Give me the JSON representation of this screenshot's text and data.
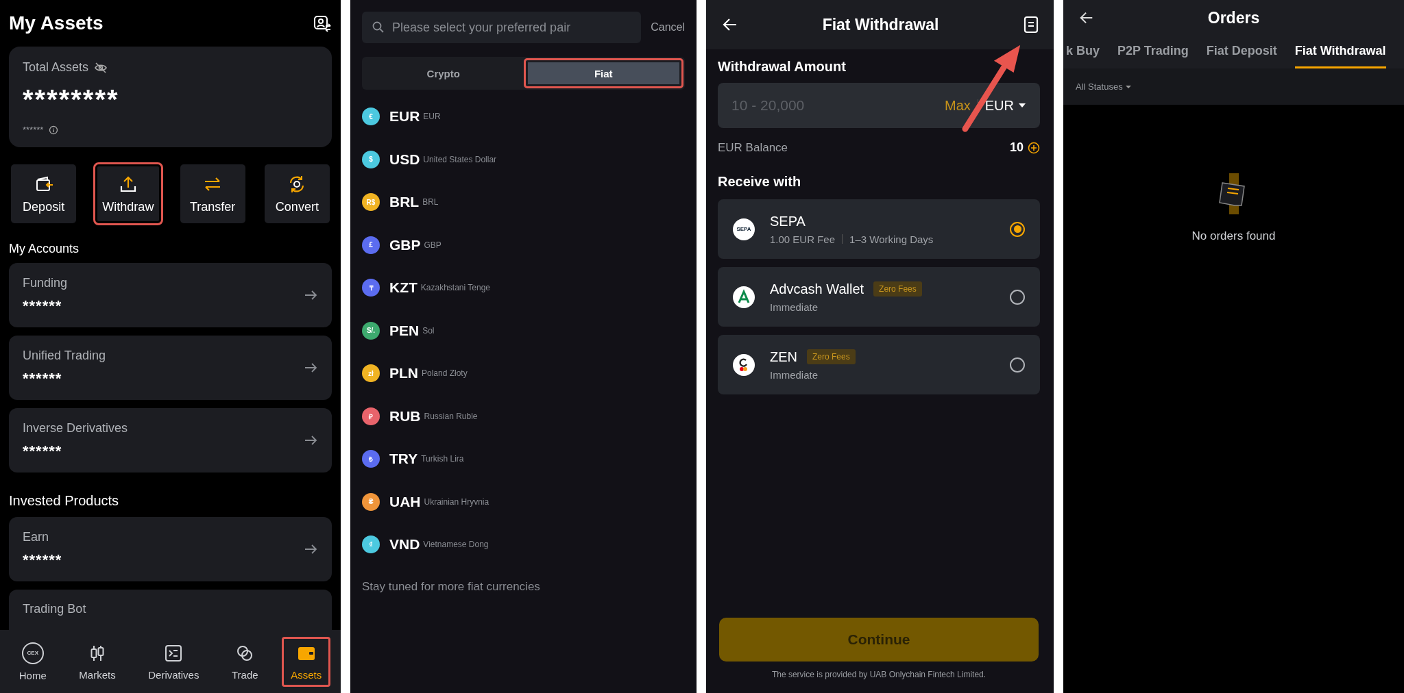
{
  "assets_screen": {
    "title": "My Assets",
    "total_card": {
      "label": "Total Assets",
      "value": "********",
      "sub_value": "******"
    },
    "actions": [
      {
        "label": "Deposit",
        "kind": "deposit",
        "highlighted": false
      },
      {
        "label": "Withdraw",
        "kind": "withdraw",
        "highlighted": true
      },
      {
        "label": "Transfer",
        "kind": "transfer",
        "highlighted": false
      },
      {
        "label": "Convert",
        "kind": "convert",
        "highlighted": false
      }
    ],
    "accounts_heading": "My Accounts",
    "accounts": [
      {
        "name": "Funding",
        "value": "******"
      },
      {
        "name": "Unified Trading",
        "value": "******"
      },
      {
        "name": "Inverse Derivatives",
        "value": "******"
      }
    ],
    "invested_heading": "Invested Products",
    "invested": [
      {
        "name": "Earn",
        "value": "******"
      },
      {
        "name": "Trading Bot"
      }
    ],
    "nav": [
      {
        "label": "Home",
        "kind": "home",
        "icon_text": "CEX",
        "selected": false,
        "highlighted": false
      },
      {
        "label": "Markets",
        "kind": "markets",
        "selected": false,
        "highlighted": false
      },
      {
        "label": "Derivatives",
        "kind": "derivatives",
        "selected": false,
        "highlighted": false
      },
      {
        "label": "Trade",
        "kind": "trade",
        "selected": false,
        "highlighted": false
      },
      {
        "label": "Assets",
        "kind": "assets",
        "selected": true,
        "highlighted": true
      }
    ]
  },
  "currency_screen": {
    "search": {
      "placeholder": "Please select your preferred pair"
    },
    "cancel": "Cancel",
    "tabs": [
      {
        "label": "Crypto",
        "selected": false,
        "highlighted": false
      },
      {
        "label": "Fiat",
        "selected": true,
        "highlighted": true
      }
    ],
    "currencies": [
      {
        "code": "EUR",
        "name": "EUR",
        "symbol": "€",
        "color": "#4cc9e0"
      },
      {
        "code": "USD",
        "name": "United States Dollar",
        "symbol": "$",
        "color": "#4cc9e0"
      },
      {
        "code": "BRL",
        "name": "BRL",
        "symbol": "R$",
        "color": "#f0b323"
      },
      {
        "code": "GBP",
        "name": "GBP",
        "symbol": "£",
        "color": "#5b6cf0"
      },
      {
        "code": "KZT",
        "name": "Kazakhstani Tenge",
        "symbol": "₸",
        "color": "#5b6cf0"
      },
      {
        "code": "PEN",
        "name": "Sol",
        "symbol": "S/.",
        "color": "#3daa6e"
      },
      {
        "code": "PLN",
        "name": "Poland Złoty",
        "symbol": "zł",
        "color": "#f0b323"
      },
      {
        "code": "RUB",
        "name": "Russian Ruble",
        "symbol": "₽",
        "color": "#e8636b"
      },
      {
        "code": "TRY",
        "name": "Turkish Lira",
        "symbol": "₺",
        "color": "#5b6cf0"
      },
      {
        "code": "UAH",
        "name": "Ukrainian Hryvnia",
        "symbol": "₴",
        "color": "#f0953a"
      },
      {
        "code": "VND",
        "name": "Vietnamese Dong",
        "symbol": "₫",
        "color": "#4cc9e0"
      }
    ],
    "footer": "Stay tuned for more fiat currencies"
  },
  "withdrawal_screen": {
    "title": "Fiat Withdrawal",
    "amount_label": "Withdrawal Amount",
    "amount": {
      "placeholder": "10 - 20,000",
      "max": "Max",
      "currency": "EUR"
    },
    "balance_label": "EUR Balance",
    "balance": "10",
    "receive_heading": "Receive with",
    "methods": [
      {
        "name": "SEPA",
        "kind": "sepa",
        "logo_text": "SEPA",
        "details": [
          "1.00 EUR Fee",
          "1–3 Working Days"
        ],
        "selected": true
      },
      {
        "name": "Advcash Wallet",
        "kind": "advcash",
        "badge": "Zero Fees",
        "details": [
          "Immediate"
        ],
        "selected": false
      },
      {
        "name": "ZEN",
        "kind": "zen",
        "badge": "Zero Fees",
        "details": [
          "Immediate"
        ],
        "selected": false
      }
    ],
    "continue_button": {
      "label": "Continue",
      "disabled": true
    },
    "footer": "The service is provided by UAB Onlychain Fintech Limited."
  },
  "orders_screen": {
    "title": "Orders",
    "tabs": [
      {
        "label": "k Buy",
        "selected": false
      },
      {
        "label": "P2P Trading",
        "selected": false
      },
      {
        "label": "Fiat Deposit",
        "selected": false
      },
      {
        "label": "Fiat Withdrawal",
        "selected": true
      }
    ],
    "filter": "All Statuses",
    "empty_text": "No orders found"
  }
}
